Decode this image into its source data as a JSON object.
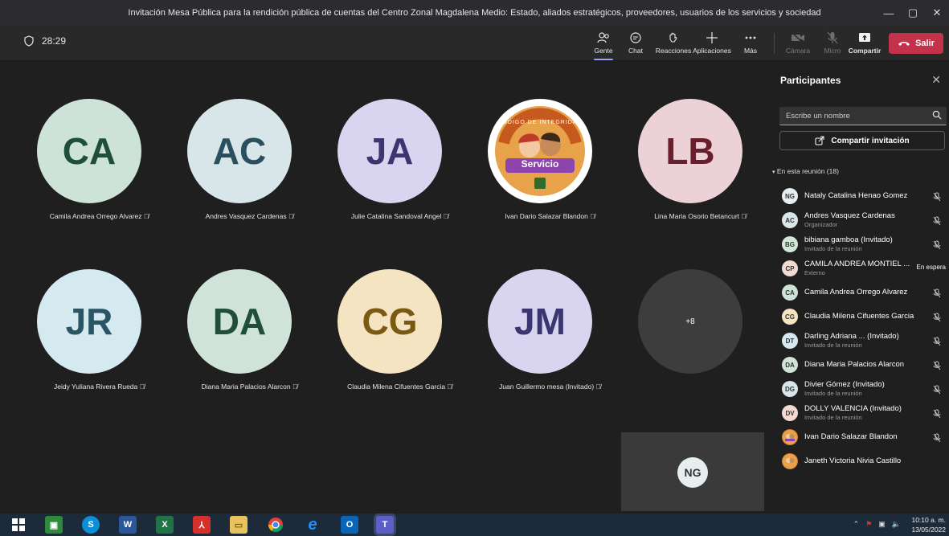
{
  "window": {
    "title": "Invitación Mesa Pública para la rendición pública de cuentas del Centro Zonal Magdalena Medio: Estado, aliados estratégicos, proveedores, usuarios de los servicios y sociedad"
  },
  "toolbar": {
    "timer": "28:29",
    "people_label": "Gente",
    "chat_label": "Chat",
    "reactions_label": "Reacciones",
    "apps_label": "Aplicaciones",
    "more_label": "Más",
    "camera_label": "Cámara",
    "mic_label": "Micro",
    "share_label": "Compartir",
    "leave_label": "Salir"
  },
  "stage": {
    "tiles": [
      {
        "initials": "CA",
        "name": "Camila Andrea Orrego Alvarez",
        "bg": "#cde3d8",
        "fg": "#1f4f3a"
      },
      {
        "initials": "AC",
        "name": "Andres Vasquez Cardenas",
        "bg": "#d8e6ea",
        "fg": "#2a4f5e"
      },
      {
        "initials": "JA",
        "name": "Julie Catalina Sandoval Angel",
        "bg": "#d9d4f0",
        "fg": "#3b3570"
      },
      {
        "initials": "",
        "name": "Ivan Dario Salazar Blandon",
        "bg": "#ffffff",
        "fg": "#333333",
        "badge_top": "CÓDIGO DE INTEGRIDAD",
        "badge_text": "Servicio"
      },
      {
        "initials": "LB",
        "name": "Lina Maria Osorio Betancurt",
        "bg": "#ecd1d6",
        "fg": "#6a1f2e"
      },
      {
        "initials": "JR",
        "name": "Jeidy Yuliana Rivera Rueda",
        "bg": "#d4eaf0",
        "fg": "#2a5564"
      },
      {
        "initials": "DA",
        "name": "Diana Maria Palacios Alarcon",
        "bg": "#cfe3d8",
        "fg": "#1f4f3a"
      },
      {
        "initials": "CG",
        "name": "Claudia Milena Cifuentes Garcia",
        "bg": "#f4e4c1",
        "fg": "#7a5a12"
      },
      {
        "initials": "JM",
        "name": "Juan Guillermo mesa (Invitado)",
        "bg": "#d9d4f0",
        "fg": "#3b3570"
      }
    ],
    "more_count": "+8",
    "self_initials": "NG"
  },
  "panel": {
    "title": "Participantes",
    "search_placeholder": "Escribe un nombre",
    "invite_label": "Compartir invitación",
    "section_label": "En esta reunión (18)",
    "participants": [
      {
        "initials": "NG",
        "name": "Nataly Catalina Henao Gomez",
        "sub": "",
        "bg": "#e5eef1"
      },
      {
        "initials": "AC",
        "name": "Andres Vasquez Cardenas",
        "sub": "Organizador",
        "bg": "#d8e6ea"
      },
      {
        "initials": "BG",
        "name": "bibiana gamboa (Invitado)",
        "sub": "Invitado de la reunión",
        "bg": "#cfe8d8"
      },
      {
        "initials": "CP",
        "name": "CAMILA ANDREA MONTIEL ...",
        "sub": "Externo",
        "bg": "#f4d9d0",
        "status": "En espera"
      },
      {
        "initials": "CA",
        "name": "Camila Andrea Orrego Alvarez",
        "sub": "",
        "bg": "#cde3d8"
      },
      {
        "initials": "CG",
        "name": "Claudia Milena Cifuentes Garcia",
        "sub": "",
        "bg": "#f4e4c1"
      },
      {
        "initials": "DT",
        "name": "Darling Adriana ... (Invitado)",
        "sub": "Invitado de la reunión",
        "bg": "#d4eaf0"
      },
      {
        "initials": "DA",
        "name": "Diana Maria Palacios Alarcon",
        "sub": "",
        "bg": "#cfe3d8"
      },
      {
        "initials": "DG",
        "name": "Divier Gómez (Invitado)",
        "sub": "Invitado de la reunión",
        "bg": "#d8e6ea"
      },
      {
        "initials": "DV",
        "name": "DOLLY VALENCIA (Invitado)",
        "sub": "Invitado de la reunión",
        "bg": "#f4d9d0"
      },
      {
        "initials": "",
        "name": "Ivan Dario Salazar Blandon",
        "sub": "",
        "bg": "#e07b39"
      },
      {
        "initials": "",
        "name": "Janeth Victoria Nivia Castillo",
        "sub": "",
        "bg": "#e07b39"
      }
    ]
  },
  "taskbar": {
    "time": "10:10 a. m.",
    "date": "13/05/2022",
    "apps": [
      {
        "icon": "windows-start-icon",
        "label": "",
        "bg": "transparent"
      },
      {
        "icon": "store-icon",
        "label": "",
        "bg": "#2e8b3a"
      },
      {
        "icon": "skype-icon",
        "label": "S",
        "bg": "#0a8fd8"
      },
      {
        "icon": "word-icon",
        "label": "W",
        "bg": "#2b579a"
      },
      {
        "icon": "excel-icon",
        "label": "X",
        "bg": "#217346"
      },
      {
        "icon": "pdf-icon",
        "label": "",
        "bg": "#d6302b"
      },
      {
        "icon": "explorer-icon",
        "label": "",
        "bg": "#e8c25a"
      },
      {
        "icon": "chrome-icon",
        "label": "",
        "bg": "transparent"
      },
      {
        "icon": "ie-icon",
        "label": "e",
        "bg": "transparent"
      },
      {
        "icon": "outlook-icon",
        "label": "O",
        "bg": "#0a64b8"
      },
      {
        "icon": "teams-icon",
        "label": "T",
        "bg": "#5b5fc7"
      }
    ]
  },
  "colors": {
    "accent": "#9ea2ff",
    "leave": "#c4314b",
    "background": "#1f1f1f"
  }
}
